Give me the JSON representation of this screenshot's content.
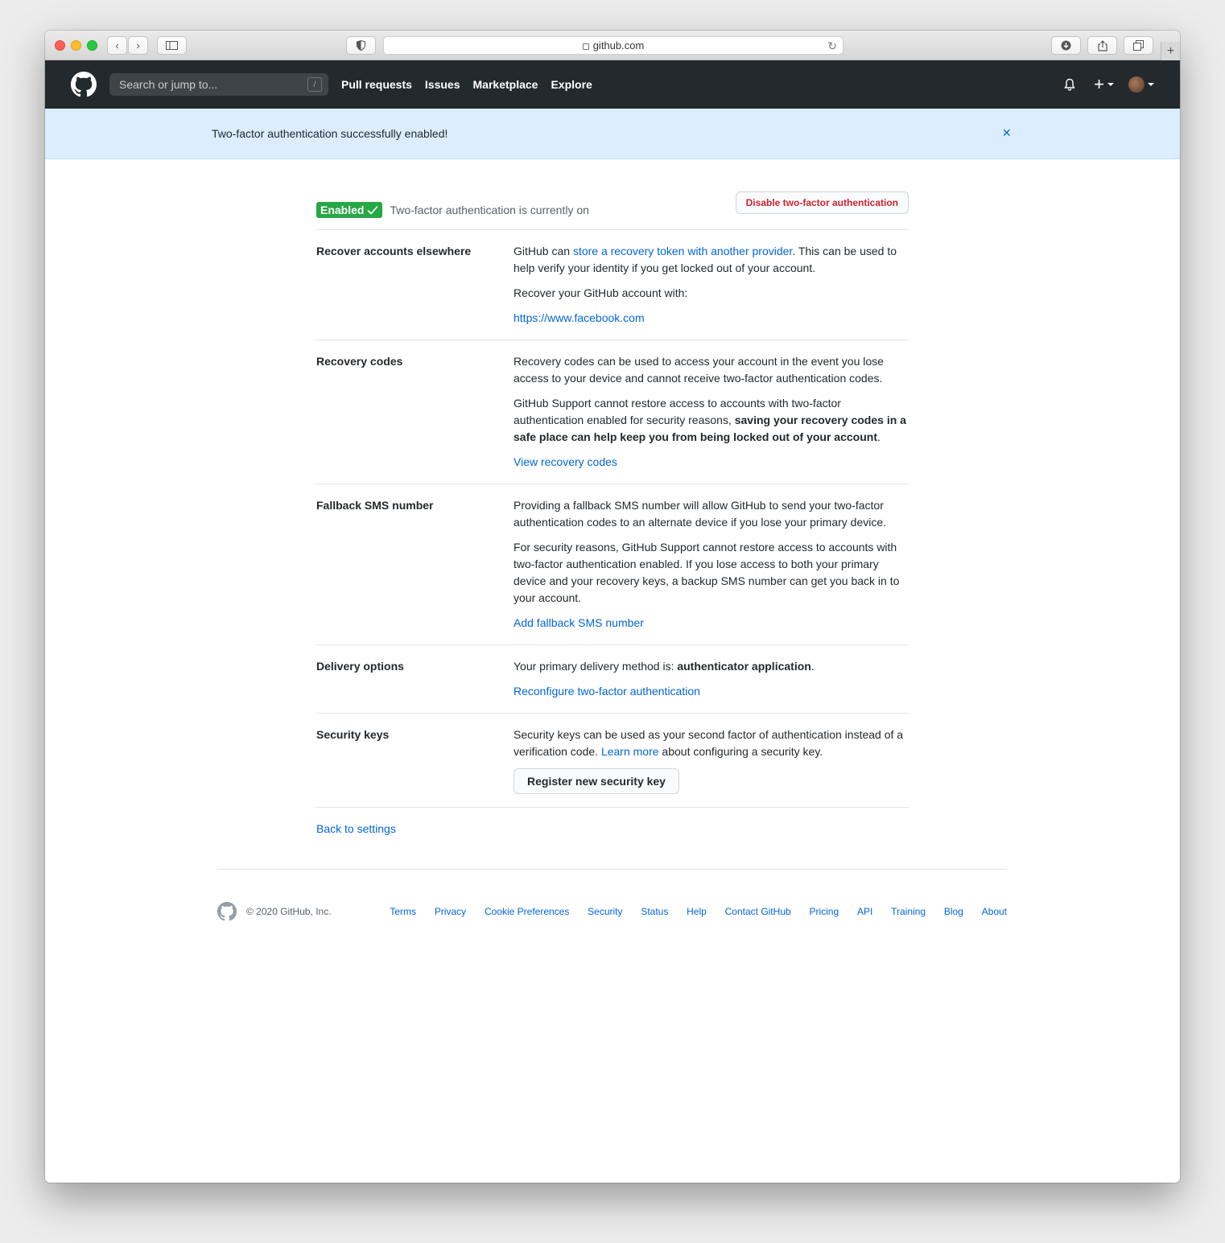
{
  "browser": {
    "url": "github.com"
  },
  "header": {
    "search_placeholder": "Search or jump to...",
    "search_shortcut": "/",
    "nav": [
      "Pull requests",
      "Issues",
      "Marketplace",
      "Explore"
    ],
    "plus": "+"
  },
  "flash": {
    "message": "Two-factor authentication successfully enabled!",
    "close": "×"
  },
  "status": {
    "badge": "Enabled",
    "text": "Two-factor authentication is currently on",
    "disable_button": "Disable two-factor authentication"
  },
  "sections": {
    "recover": {
      "label": "Recover accounts elsewhere",
      "p1_a": "GitHub can ",
      "p1_link": "store a recovery token with another provider",
      "p1_b": ". This can be used to help verify your identity if you get locked out of your account.",
      "p2": "Recover your GitHub account with:",
      "provider_link": "https://www.facebook.com"
    },
    "recovery_codes": {
      "label": "Recovery codes",
      "p1": "Recovery codes can be used to access your account in the event you lose access to your device and cannot receive two-factor authentication codes.",
      "p2_a": "GitHub Support cannot restore access to accounts with two-factor authentication enabled for security reasons, ",
      "p2_bold": "saving your recovery codes in a safe place can help keep you from being locked out of your account",
      "p2_b": ".",
      "link": "View recovery codes"
    },
    "fallback_sms": {
      "label": "Fallback SMS number",
      "p1": "Providing a fallback SMS number will allow GitHub to send your two-factor authentication codes to an alternate device if you lose your primary device.",
      "p2": "For security reasons, GitHub Support cannot restore access to accounts with two-factor authentication enabled. If you lose access to both your primary device and your recovery keys, a backup SMS number can get you back in to your account.",
      "link": "Add fallback SMS number"
    },
    "delivery": {
      "label": "Delivery options",
      "p1_a": "Your primary delivery method is: ",
      "p1_bold": "authenticator application",
      "p1_b": ".",
      "link": "Reconfigure two-factor authentication"
    },
    "security_keys": {
      "label": "Security keys",
      "p1_a": "Security keys can be used as your second factor of authentication instead of a verification code. ",
      "p1_link": "Learn more",
      "p1_b": " about configuring a security key.",
      "button": "Register new security key"
    }
  },
  "back_link": "Back to settings",
  "footer": {
    "copyright": "© 2020 GitHub, Inc.",
    "links": [
      "Terms",
      "Privacy",
      "Cookie Preferences",
      "Security",
      "Status",
      "Help",
      "Contact GitHub",
      "Pricing",
      "API",
      "Training",
      "Blog",
      "About"
    ]
  },
  "colors": {
    "header_bg": "#24292e",
    "flash_bg": "#dbedff",
    "link": "#0366d6",
    "enabled_badge": "#28a745",
    "danger": "#cb2431"
  }
}
